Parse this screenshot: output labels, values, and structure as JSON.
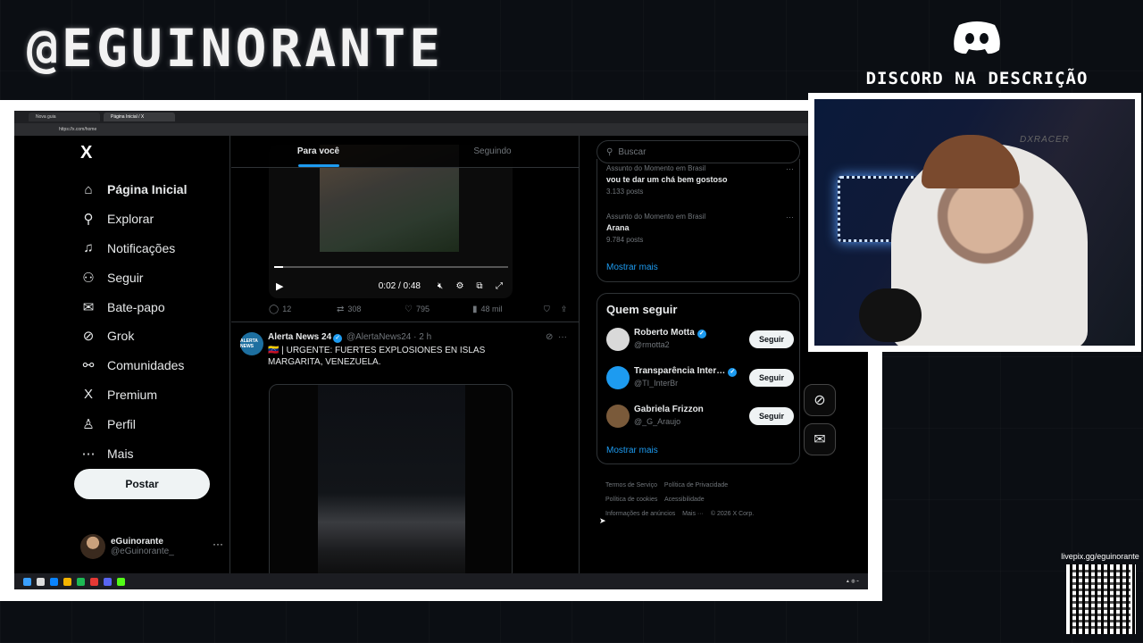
{
  "overlay": {
    "brand": "@EGUINORANTE",
    "discord_text": "DISCORD NA DESCRIÇÃO",
    "qr_label": "livepix.gg/eguinorante"
  },
  "browser": {
    "tabs": [
      "Nova guia",
      "Página Inicial / X"
    ],
    "url": "https://x.com/home"
  },
  "nav": {
    "logo": "X",
    "items": [
      {
        "label": "Página Inicial",
        "icon": "home-icon",
        "glyph": "⌂"
      },
      {
        "label": "Explorar",
        "icon": "search-icon",
        "glyph": "⚲"
      },
      {
        "label": "Notificações",
        "icon": "bell-icon",
        "glyph": "♫"
      },
      {
        "label": "Seguir",
        "icon": "add-user-icon",
        "glyph": "⚇"
      },
      {
        "label": "Bate-papo",
        "icon": "mail-icon",
        "glyph": "✉"
      },
      {
        "label": "Grok",
        "icon": "grok-icon",
        "glyph": "⊘"
      },
      {
        "label": "Comunidades",
        "icon": "communities-icon",
        "glyph": "⚯"
      },
      {
        "label": "Premium",
        "icon": "x-premium-icon",
        "glyph": "X"
      },
      {
        "label": "Perfil",
        "icon": "profile-icon",
        "glyph": "♙"
      },
      {
        "label": "Mais",
        "icon": "more-circle-icon",
        "glyph": "⋯"
      }
    ],
    "post_label": "Postar",
    "profile": {
      "name": "eGuinorante",
      "handle": "@eGuinorante_",
      "more": "···"
    }
  },
  "timeline": {
    "tabs": [
      "Para você",
      "Seguindo"
    ],
    "video1": {
      "time": "0:02 / 0:48",
      "progress": 0.04
    },
    "actions": {
      "replies": "12",
      "reposts": "308",
      "likes": "795",
      "views": "48 mil"
    },
    "tweet": {
      "avatar_text": "ALERTA NEWS",
      "name": "Alerta News 24",
      "handle": "@AlertaNews24 · 2 h",
      "text": "🇻🇪 | URGENTE: FUERTES EXPLOSIONES EN ISLAS MARGARITA, VENEZUELA."
    }
  },
  "right": {
    "search_placeholder": "Buscar",
    "trends": [
      {
        "meta": "Assunto do Momento em Brasil",
        "title": "vou te dar um chá bem gostoso",
        "count": "3.133 posts"
      },
      {
        "meta": "Assunto do Momento em Brasil",
        "title": "Arana",
        "count": "9.784 posts"
      }
    ],
    "show_more": "Mostrar mais",
    "who_title": "Quem seguir",
    "who": [
      {
        "name": "Roberto Motta",
        "handle": "@rmotta2",
        "color": "#d9d9d9"
      },
      {
        "name": "Transparência Inter…",
        "handle": "@TI_InterBr",
        "color": "#1d9bf0"
      },
      {
        "name": "Gabriela Frizzon",
        "handle": "@_G_Araujo",
        "color": "#7a5a3a"
      }
    ],
    "follow_label": "Seguir",
    "show_more2": "Mostrar mais",
    "footer": [
      "Termos de Serviço",
      "Política de Privacidade",
      "Política de cookies",
      "Acessibilidade",
      "Informações de anúncios",
      "Mais ···",
      "© 2026 X Corp."
    ]
  },
  "webcam": {
    "chair_brand": "DXRACER"
  }
}
